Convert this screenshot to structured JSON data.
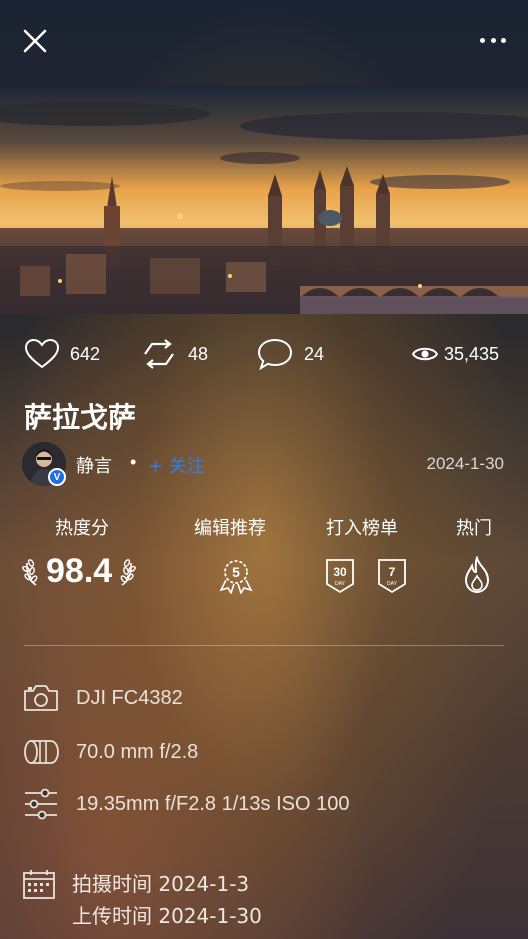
{
  "header": {
    "close_icon": "close-icon",
    "more_icon": "more-icon"
  },
  "stats": {
    "likes": "642",
    "reposts": "48",
    "comments": "24",
    "views": "35,435"
  },
  "photo": {
    "title": "萨拉戈萨"
  },
  "author": {
    "name": "静言",
    "separator": "•",
    "follow_label": "+ 关注",
    "verified_badge": "V",
    "date": "2024-1-30"
  },
  "awards": {
    "heat_label": "热度分",
    "heat_score": "98.4",
    "editor_label": "编辑推荐",
    "editor_badge": "5",
    "ranking_label": "打入榜单",
    "ranking_badges": [
      {
        "num": "30",
        "unit": "DAY"
      },
      {
        "num": "7",
        "unit": "DAY"
      }
    ],
    "hot_label": "热门"
  },
  "exif": {
    "camera": "DJI FC4382",
    "lens": "70.0 mm f/2.8",
    "settings": "19.35mm f/F2.8 1/13s ISO 100"
  },
  "times": {
    "shot": "拍摄时间 2024-1-3",
    "uploaded": "上传时间 2024-1-30"
  }
}
